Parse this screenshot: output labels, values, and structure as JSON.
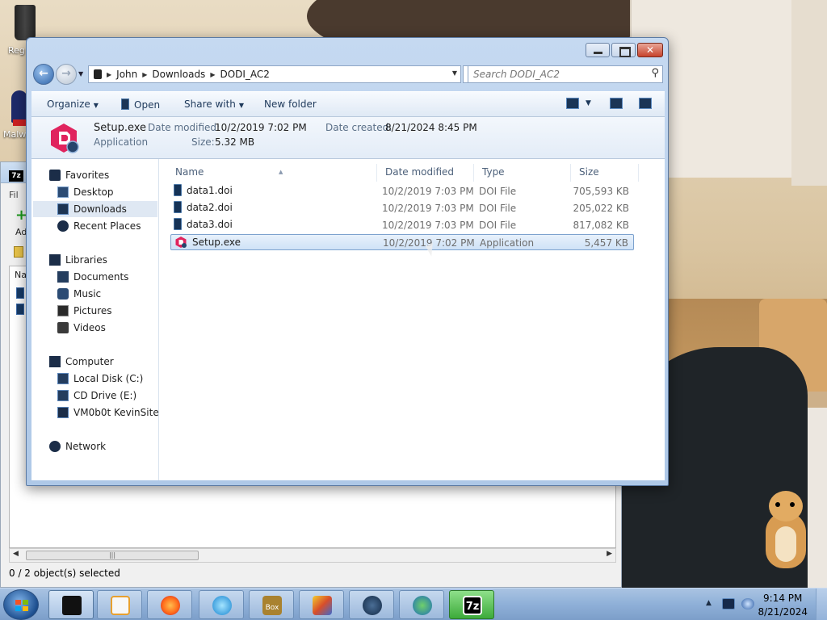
{
  "desktop": {
    "icons": [
      {
        "label": "Reg"
      },
      {
        "label": "Malw"
      }
    ]
  },
  "background_window": {
    "menu_fragment": "Fil",
    "add_fragment": "Ad",
    "name_header_fragment": "Na",
    "status": "0 / 2 object(s) selected"
  },
  "explorer": {
    "address": {
      "crumbs": [
        "John",
        "Downloads",
        "DODI_AC2"
      ]
    },
    "search": {
      "placeholder": "Search DODI_AC2"
    },
    "toolbar": {
      "organize": "Organize",
      "open": "Open",
      "share_with": "Share with",
      "new_folder": "New folder"
    },
    "details_pane": {
      "file_name": "Setup.exe",
      "file_type": "Application",
      "date_modified_label": "Date modified:",
      "date_modified_value": "10/2/2019 7:02 PM",
      "date_created_label": "Date created:",
      "date_created_value": "8/21/2024 8:45 PM",
      "size_label": "Size:",
      "size_value": "5.32 MB"
    },
    "nav_pane": {
      "favorites": "Favorites",
      "desktop": "Desktop",
      "downloads": "Downloads",
      "recent_places": "Recent Places",
      "libraries": "Libraries",
      "documents": "Documents",
      "music": "Music",
      "pictures": "Pictures",
      "videos": "Videos",
      "computer": "Computer",
      "local_disk": "Local Disk (C:)",
      "cd_drive": "CD Drive (E:)",
      "vm_share": "VM0b0t KevinSite",
      "network": "Network"
    },
    "columns": {
      "name": "Name",
      "date_modified": "Date modified",
      "type": "Type",
      "size": "Size"
    },
    "files": [
      {
        "name": "data1.doi",
        "date": "10/2/2019 7:03 PM",
        "type": "DOI File",
        "size": "705,593 KB",
        "icon": "doi-file-icon"
      },
      {
        "name": "data2.doi",
        "date": "10/2/2019 7:03 PM",
        "type": "DOI File",
        "size": "205,022 KB",
        "icon": "doi-file-icon"
      },
      {
        "name": "data3.doi",
        "date": "10/2/2019 7:03 PM",
        "type": "DOI File",
        "size": "817,082 KB",
        "icon": "doi-file-icon"
      },
      {
        "name": "Setup.exe",
        "date": "10/2/2019 7:02 PM",
        "type": "Application",
        "size": "5,457 KB",
        "icon": "setup-app-icon",
        "selected": true
      }
    ]
  },
  "taskbar": {
    "apps": [
      {
        "name": "explorer",
        "icon": "explorer-folder-icon"
      },
      {
        "name": "media-player",
        "icon": "media-player-icon"
      },
      {
        "name": "firefox",
        "icon": "firefox-icon"
      },
      {
        "name": "browser",
        "icon": "blue-circle-app-icon"
      },
      {
        "name": "box-game",
        "icon": "box-game-icon",
        "label": "Box"
      },
      {
        "name": "winrar-like",
        "icon": "archive-app-icon"
      },
      {
        "name": "steam",
        "icon": "steam-icon"
      },
      {
        "name": "idm",
        "icon": "download-manager-icon"
      },
      {
        "name": "7zip",
        "icon": "7zip-icon",
        "label": "7z"
      }
    ],
    "clock": {
      "time": "9:14 PM",
      "date": "8/21/2024"
    }
  },
  "colors": {
    "accent": "#2d63a9",
    "selection": "#cfe2f7",
    "setup_icon": "#e0245e"
  }
}
